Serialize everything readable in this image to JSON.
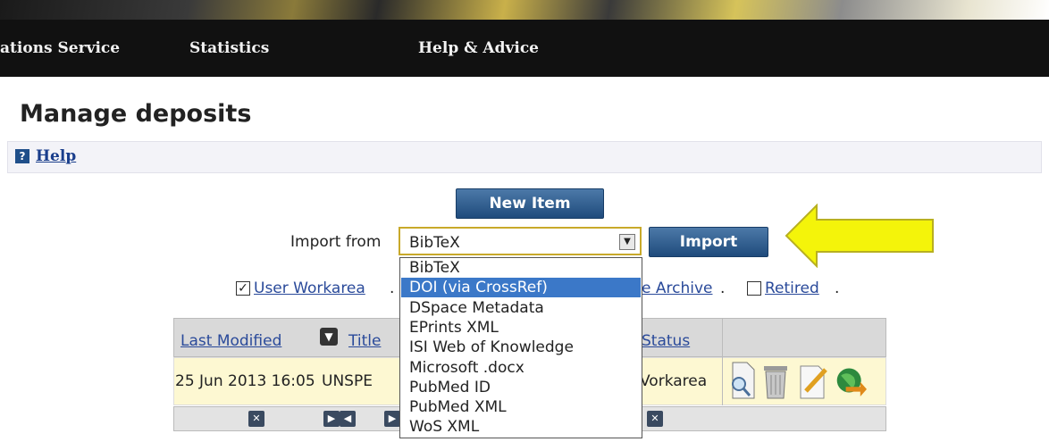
{
  "nav": {
    "items": [
      {
        "label": "ations Service"
      },
      {
        "label": "Statistics"
      },
      {
        "label": "Help & Advice"
      }
    ]
  },
  "page": {
    "title": "Manage deposits",
    "help_link": "Help"
  },
  "toolbar": {
    "new_item_label": "New Item",
    "import_from_label": "Import from",
    "import_button_label": "Import",
    "import_selected": "BibTeX",
    "import_options": [
      "BibTeX",
      "DOI (via CrossRef)",
      "DSpace Metadata",
      "EPrints XML",
      "ISI Web of Knowledge",
      "Microsoft .docx",
      "PubMed ID",
      "PubMed XML",
      "WoS XML"
    ],
    "highlighted_option": "DOI (via CrossRef)"
  },
  "filters": {
    "user_workarea": {
      "label": "User Workarea",
      "checked": true
    },
    "live_archive_fragment": "e Archive",
    "retired": {
      "label": "Retired",
      "checked": false
    }
  },
  "table": {
    "headers": {
      "last_modified": "Last Modified",
      "title": "Title",
      "status": "Status"
    },
    "rows": [
      {
        "last_modified": "25 Jun 2013 16:05",
        "title": "UNSPE",
        "status": "Vorkarea"
      }
    ]
  },
  "colors": {
    "nav_bg": "#111111",
    "button": "#2b5a8c",
    "highlight": "#3b78c8",
    "row_bg": "#fdf8d2",
    "arrow": "#f4f40a"
  }
}
